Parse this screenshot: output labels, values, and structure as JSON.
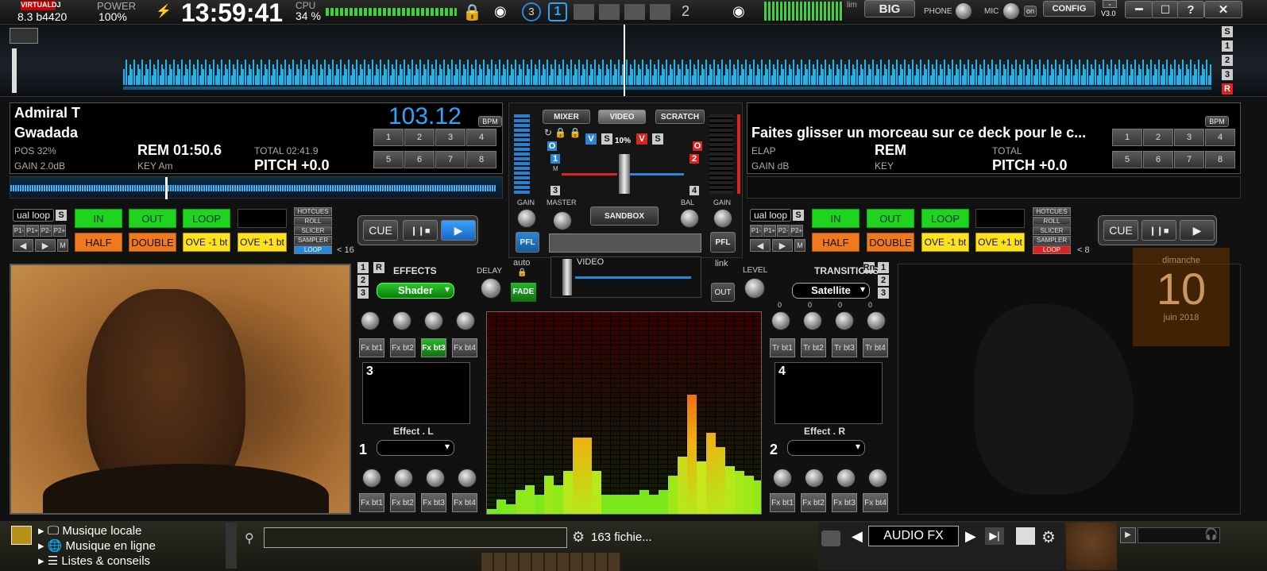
{
  "top": {
    "logo": "VIRTUALDJ",
    "version": "8.3 b4420",
    "power_label": "POWER",
    "power_value": "100%",
    "clock": "13:59:41",
    "cpu_label": "CPU",
    "cpu_value": "34 %",
    "deck_one": "1",
    "deck_two": "2",
    "layers": "3",
    "lim": "lim",
    "big": "BIG",
    "phone": "PHONE",
    "mic": "MIC",
    "on": "on",
    "config": "CONFIG",
    "v3": "V3.0"
  },
  "waveform_side": [
    "S",
    "1",
    "2",
    "3",
    "R"
  ],
  "deck_left": {
    "artist": "Admiral T",
    "title": "Gwadada",
    "bpm": "103.12",
    "bpm_label": "BPM",
    "pos": "POS 32%",
    "rem": "REM 01:50.6",
    "total": "TOTAL 02:41.9",
    "gain": "GAIN 2.0dB",
    "key": "KEY Am",
    "pitch": "PITCH +0.0",
    "pads": [
      "1",
      "2",
      "3",
      "4",
      "5",
      "6",
      "7",
      "8"
    ]
  },
  "deck_right": {
    "title": "Faites glisser un morceau sur ce deck pour le c...",
    "bpm_label": "BPM",
    "elap": "ELAP",
    "rem": "REM",
    "total": "TOTAL",
    "gain": "GAIN dB",
    "key": "KEY",
    "pitch": "PITCH +0.0",
    "pads": [
      "1",
      "2",
      "3",
      "4",
      "5",
      "6",
      "7",
      "8"
    ]
  },
  "mixer": {
    "tabs": [
      "MIXER",
      "VIDEO",
      "SCRATCH"
    ],
    "pct": "10%",
    "v": "V",
    "s": "S",
    "o": "O",
    "gain": "GAIN",
    "master": "MASTER",
    "sandbox": "SANDBOX",
    "bal": "BAL",
    "pfl": "PFL",
    "video_label": "VIDEO",
    "link": "link",
    "out": "OUT",
    "m": "M",
    "ch": [
      "1",
      "3",
      "2",
      "4"
    ]
  },
  "loop_left": {
    "mode": "ual loop",
    "s": "S",
    "p": [
      "P1-",
      "P1+",
      "P2-",
      "P2+"
    ],
    "m": "M",
    "in": "IN",
    "out": "OUT",
    "loop": "LOOP",
    "half": "HALF",
    "double": "DOUBLE",
    "move_m": "OVE -1 bt",
    "move_p": "OVE +1 bt",
    "menu": [
      "HOTCUES",
      "ROLL",
      "SLICER",
      "SAMPLER",
      "LOOP"
    ],
    "count": "< 16",
    "cue": "CUE"
  },
  "loop_right": {
    "mode": "ual loop",
    "s": "S",
    "p": [
      "P1-",
      "P1+",
      "P2-",
      "P2+"
    ],
    "m": "M",
    "in": "IN",
    "out": "OUT",
    "loop": "LOOP",
    "half": "HALF",
    "double": "DOUBLE",
    "move_m": "OVE -1 bt",
    "move_p": "OVE +1 bt",
    "menu": [
      "HOTCUES",
      "ROLL",
      "SLICER",
      "SAMPLER",
      "LOOP"
    ],
    "count": "< 8",
    "cue": "CUE"
  },
  "effects": {
    "title": "EFFECTS",
    "delay": "DELAY",
    "auto": "auto",
    "fade": "FADE",
    "shader": "Shader",
    "buttons": [
      "Fx bt1",
      "Fx bt2",
      "Fx bt3",
      "Fx bt4"
    ],
    "slot_a": "3",
    "label_a": "Effect . L",
    "slot_b": "1",
    "side": [
      "1",
      "R",
      "2",
      "3"
    ]
  },
  "transitions": {
    "title": "TRANSITIONS",
    "level": "LEVEL",
    "satellite": "Satellite",
    "buttons": [
      "Tr bt1",
      "Tr bt2",
      "Tr bt3",
      "Tr bt4"
    ],
    "slot_a": "4",
    "label_a": "Effect . R",
    "slot_b": "2",
    "zeros": [
      "0",
      "0",
      "0",
      "0"
    ],
    "side": [
      "Rn",
      "1",
      "2",
      "3"
    ]
  },
  "calendar": {
    "day": "dimanche",
    "date": "10",
    "month": "juin 2018"
  },
  "browser": {
    "items": [
      "Musique locale",
      "Musique en ligne",
      "Listes & conseils"
    ],
    "files": "163 fichie...",
    "audiofx": "AUDIO FX"
  },
  "colors": {
    "accent": "#2aa6ff",
    "green": "#1ed41e",
    "orange": "#f0781e",
    "yellow": "#ffe11e"
  }
}
